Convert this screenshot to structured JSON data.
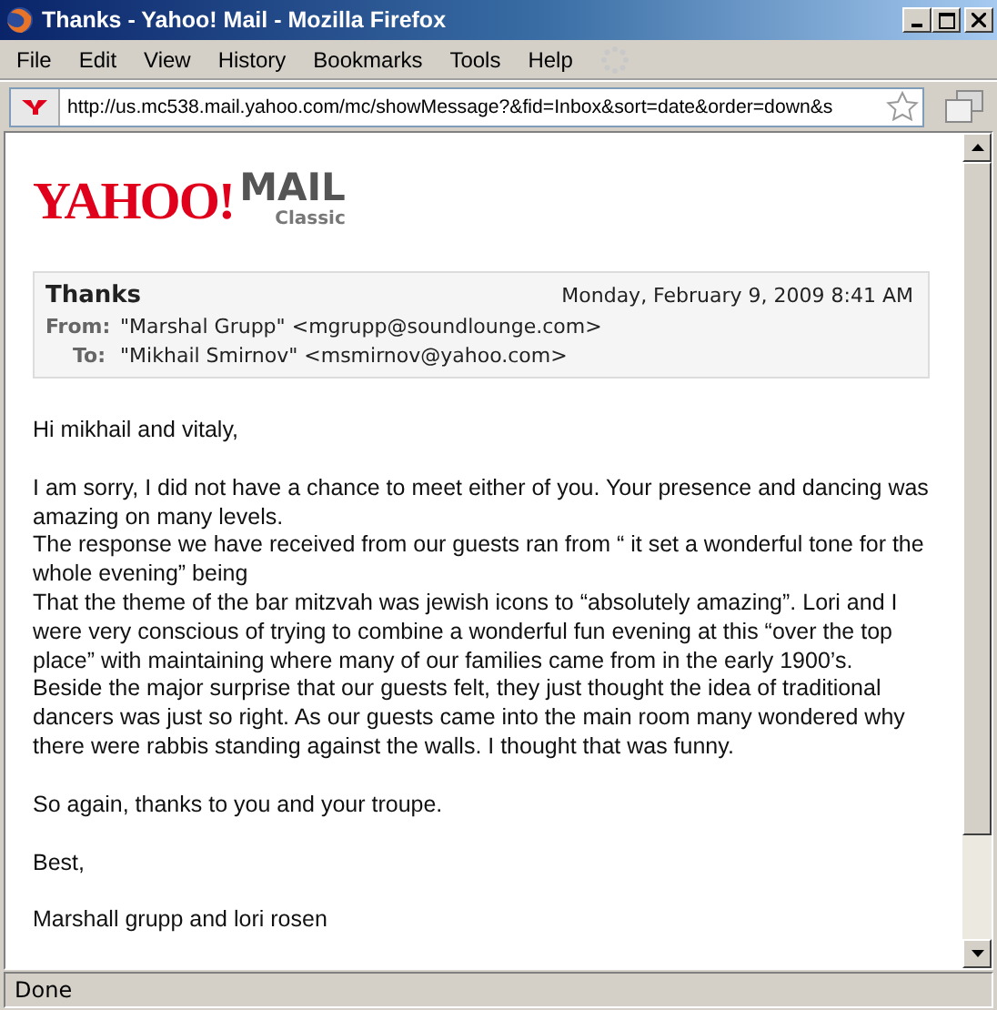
{
  "window": {
    "title": "Thanks - Yahoo! Mail - Mozilla Firefox"
  },
  "menu": [
    "File",
    "Edit",
    "View",
    "History",
    "Bookmarks",
    "Tools",
    "Help"
  ],
  "address_bar": {
    "value": "http://us.mc538.mail.yahoo.com/mc/showMessage?&fid=Inbox&sort=date&order=down&s"
  },
  "logo": {
    "brand": "YAHOO!",
    "product": "MAIL",
    "edition": "Classic"
  },
  "message": {
    "subject": "Thanks",
    "date": "Monday, February 9, 2009 8:41 AM",
    "from_label": "From:",
    "from": "\"Marshal Grupp\" <mgrupp@soundlounge.com>",
    "to_label": "To:",
    "to": "\"Mikhail Smirnov\" <msmirnov@yahoo.com>",
    "body": [
      [
        "Hi mikhail and vitaly,"
      ],
      [
        "I am sorry, I did not have a chance to meet either of you. Your presence and dancing was amazing on many levels.",
        "The response we have received from our guests ran from “ it set a wonderful tone for the whole evening”  being",
        "That the theme of the bar mitzvah was jewish icons to “absolutely amazing”.  Lori and I were very conscious of trying to combine a wonderful fun evening at this “over the top place” with maintaining where many of our families came from in the early 1900’s.",
        "Beside the major surprise that our guests felt, they just thought the idea of traditional dancers was just so right. As our guests came into the main room many  wondered why there were  rabbis standing against the walls. I thought that was funny."
      ],
      [
        "So again, thanks to you and your troupe."
      ],
      [
        "Best,"
      ],
      [
        "Marshall grupp and lori rosen"
      ]
    ]
  },
  "status_bar": "Done"
}
